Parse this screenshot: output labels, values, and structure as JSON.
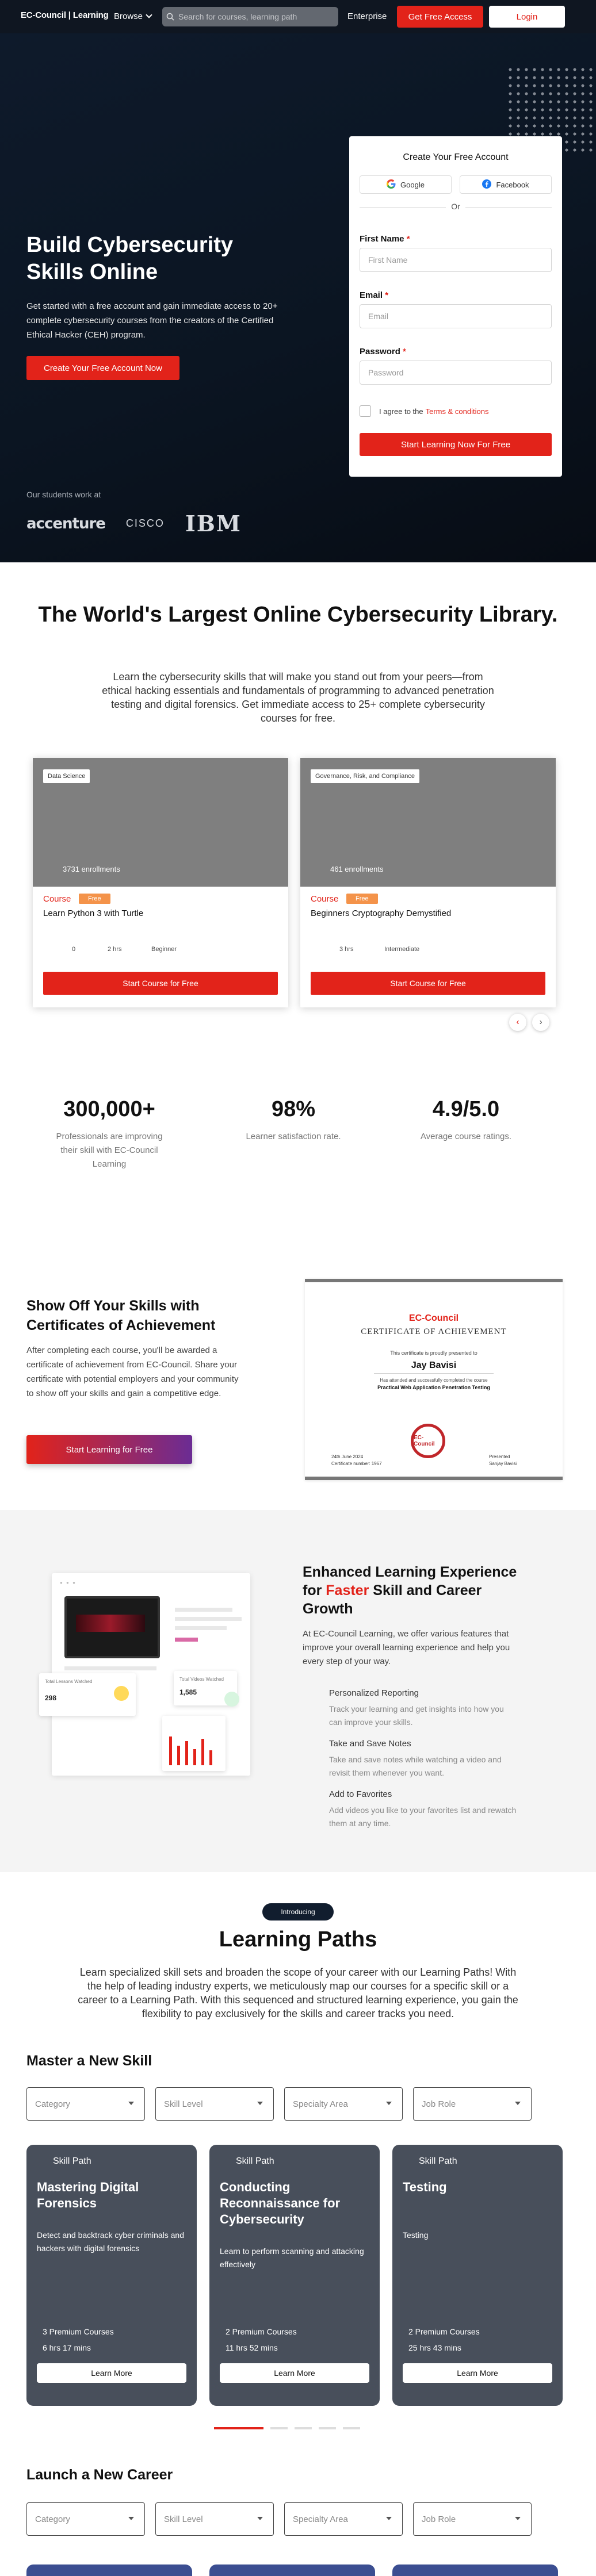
{
  "nav": {
    "logo": "EC-Council | Learning",
    "browse": "Browse",
    "search_placeholder": "Search for courses, learning path",
    "enterprise": "Enterprise",
    "get_free_access": "Get Free Access",
    "login": "Login"
  },
  "hero": {
    "title": "Build Cybersecurity Skills Online",
    "subtitle": "Get started with a free account and gain immediate access to 20+ complete cybersecurity courses from the creators of the Certified Ethical Hacker (CEH) program.",
    "cta": "Create Your Free Account Now",
    "students_label": "Our students work at",
    "logos": [
      "accenture",
      "CISCO",
      "IBM"
    ]
  },
  "form": {
    "title": "Create Your Free Account",
    "google": "Google",
    "facebook": "Facebook",
    "or": "Or",
    "first_name_label": "First Name",
    "first_name_placeholder": "First Name",
    "email_label": "Email",
    "email_placeholder": "Email",
    "password_label": "Password",
    "password_placeholder": "Password",
    "required_mark": "*",
    "agree_text": "I agree to the",
    "terms": "Terms & conditions",
    "submit": "Start Learning Now For Free"
  },
  "library": {
    "title": "The World's Largest Online Cybersecurity Library.",
    "subtitle": "Learn the cybersecurity skills that will make you stand out from your peers—from ethical hacking essentials and fundamentals of programming to advanced penetration testing and digital forensics. Get immediate access to 25+ complete cybersecurity courses for free.",
    "cards": [
      {
        "tag": "Data Science",
        "enrollments": "3731 enrollments",
        "type": "Course",
        "badge": "Free",
        "title": "Learn Python 3 with Turtle",
        "meta": [
          "0",
          "2 hrs",
          "Beginner"
        ],
        "button": "Start Course for Free"
      },
      {
        "tag": "Governance, Risk, and Compliance",
        "enrollments": "461 enrollments",
        "type": "Course",
        "badge": "Free",
        "title": "Beginners Cryptography Demystified",
        "meta": [
          "",
          "3 hrs",
          "Intermediate"
        ],
        "button": "Start Course for Free"
      }
    ],
    "prev": "‹",
    "next": "›"
  },
  "stats": [
    {
      "value": "300,000+",
      "label": "Professionals are improving their skill with EC-Council Learning"
    },
    {
      "value": "98%",
      "label": "Learner satisfaction rate."
    },
    {
      "value": "4.9/5.0",
      "label": "Average course ratings."
    }
  ],
  "certificate": {
    "title": "Show Off Your Skills with Certificates of Achievement",
    "text": "After completing each course, you'll be awarded a certificate of achievement from EC-Council. Share your certificate with potential employers and your community to show off your skills and gain a competitive edge.",
    "button": "Start Learning for Free",
    "brand": "EC-Council",
    "heading": "CERTIFICATE OF ACHIEVEMENT",
    "proud": "This certificate is proudly presented to",
    "name": "Jay Bavisi",
    "attended": "Has attended and successfully completed the course",
    "course": "Practical Web Application Penetration Testing",
    "seal": "EC-Council",
    "date": "24th June 2024",
    "date_label": "Certificate number: 1967",
    "presenter": "Presented",
    "presenter_name": "Sanjay Bavisi"
  },
  "enhanced": {
    "title_a": "Enhanced Learning Experience for ",
    "title_fast": "Faster",
    "title_b": " Skill and Career Growth",
    "text": "At EC-Council Learning, we offer various features that improve your overall learning experience and help you every step of your way.",
    "features": [
      {
        "title": "Personalized Reporting",
        "desc": "Track your learning and get insights into how you can improve your skills."
      },
      {
        "title": "Take and Save Notes",
        "desc": "Take and save notes while watching a video and revisit them whenever you want."
      },
      {
        "title": "Add to Favorites",
        "desc": "Add videos you like to your favorites list and rewatch them at any time."
      }
    ],
    "mock": {
      "lessons_label": "Total Lessons Watched",
      "lessons_value": "298",
      "videos_label": "Total Videos Watched",
      "videos_value": "1,585"
    }
  },
  "paths": {
    "badge": "Introducing",
    "title": "Learning Paths",
    "subtitle": "Learn specialized skill sets and broaden the scope of your career with our Learning Paths! With the help of leading industry experts, we meticulously map our courses for a specific skill or a career to a Learning Path. With this sequenced and structured learning experience, you gain the flexibility to pay exclusively for the skills and career tracks you need.",
    "master_heading": "Master a New Skill",
    "career_heading": "Launch a New Career",
    "filters": [
      "Category",
      "Skill Level",
      "Specialty Area",
      "Job Role"
    ],
    "cards": [
      {
        "kind": "Skill Path",
        "title": "Mastering Digital Forensics",
        "desc": "Detect and backtrack cyber criminals and hackers with digital forensics",
        "courses": "3 Premium Courses",
        "duration": "6 hrs 17 mins",
        "button": "Learn More"
      },
      {
        "kind": "Skill Path",
        "title": "Conducting Reconnaissance for Cybersecurity",
        "desc": "Learn to perform scanning and attacking effectively",
        "courses": "2 Premium Courses",
        "duration": "11 hrs 52 mins",
        "button": "Learn More"
      },
      {
        "kind": "Skill Path",
        "title": "Testing",
        "desc": "Testing",
        "courses": "2 Premium Courses",
        "duration": "25 hrs 43 mins",
        "button": "Learn More"
      }
    ]
  },
  "colors": {
    "accent": "#e2231a",
    "dark": "#0f1621",
    "card": "#484f5b"
  }
}
